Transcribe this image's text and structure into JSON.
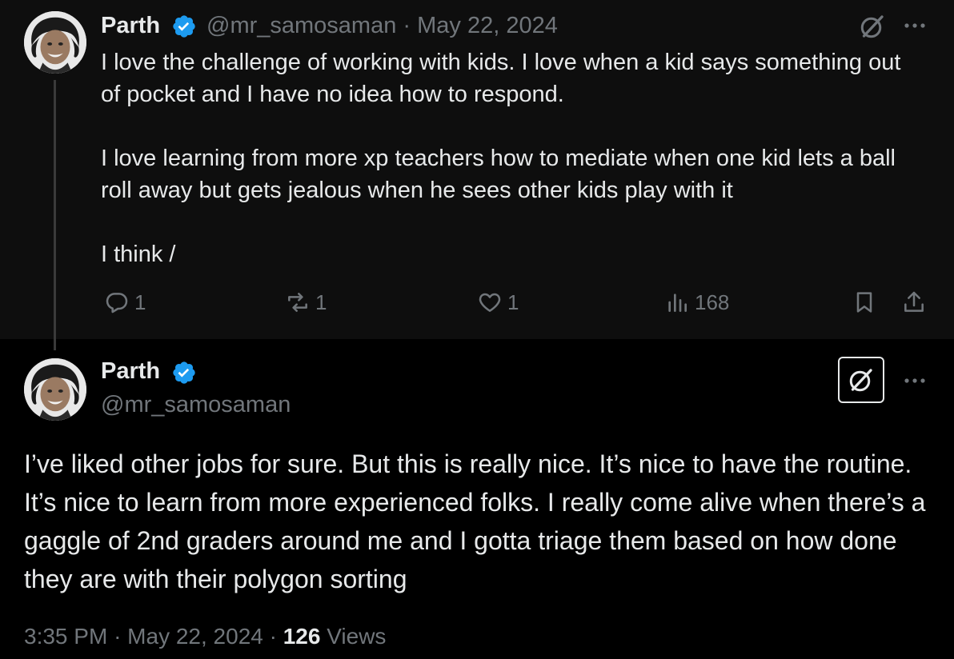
{
  "parent_tweet": {
    "author_name": "Parth",
    "handle": "@mr_samosaman",
    "separator": "·",
    "date": "May 22, 2024",
    "paragraphs": [
      "I love the challenge of working with kids. I love when a kid says something out of pocket and I have no idea how to respond.",
      "I love learning from more xp teachers how to mediate when one kid lets a ball roll away but gets jealous when he sees other kids play with it",
      "I think /"
    ],
    "actions": {
      "replies": "1",
      "reposts": "1",
      "likes": "1",
      "views": "168"
    },
    "icons": {
      "reply": "reply-icon",
      "repost": "repost-icon",
      "like": "heart-icon",
      "views": "bar-chart-icon",
      "bookmark": "bookmark-icon",
      "share": "share-icon",
      "grok": "grok-icon",
      "more": "more-icon"
    }
  },
  "main_tweet": {
    "author_name": "Parth",
    "handle": "@mr_samosaman",
    "text": "I’ve liked other jobs for sure. But this is really nice. It’s nice to have the routine. It’s nice to learn from more experienced folks. I really come alive when there’s a gaggle of 2nd graders around me and I gotta triage them based on how done they are with their polygon sorting",
    "time": "3:35 PM",
    "date": "May 22, 2024",
    "separator": "·",
    "views_count": "126",
    "views_label": "Views"
  },
  "colors": {
    "background": "#000000",
    "parent_background": "#0e0e0e",
    "text_primary": "#e7e9ea",
    "text_secondary": "#71767b",
    "verified_blue": "#1d9bf0"
  }
}
